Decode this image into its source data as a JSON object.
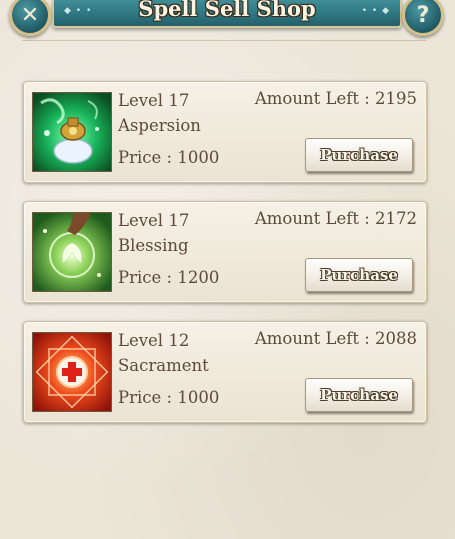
{
  "header": {
    "title": "Spell Sell Shop",
    "close_icon": "close-icon",
    "help_label": "?",
    "close_label": "✕",
    "deco_left": "◆ • •",
    "deco_right": "• • ◆"
  },
  "spells": [
    {
      "level": "Level 17",
      "name": "Aspersion",
      "price": "Price : 1000",
      "amount": "Amount Left : 2195",
      "button": "Purchase",
      "icon": "aspersion-icon"
    },
    {
      "level": "Level 17",
      "name": "Blessing",
      "price": "Price : 1200",
      "amount": "Amount Left : 2172",
      "button": "Purchase",
      "icon": "blessing-icon"
    },
    {
      "level": "Level 12",
      "name": "Sacrament",
      "price": "Price : 1000",
      "amount": "Amount Left : 2088",
      "button": "Purchase",
      "icon": "sacrament-icon"
    }
  ],
  "colors": {
    "banner": "#2a6f7a",
    "card": "#f3ede1",
    "text": "#5b4a3b"
  }
}
